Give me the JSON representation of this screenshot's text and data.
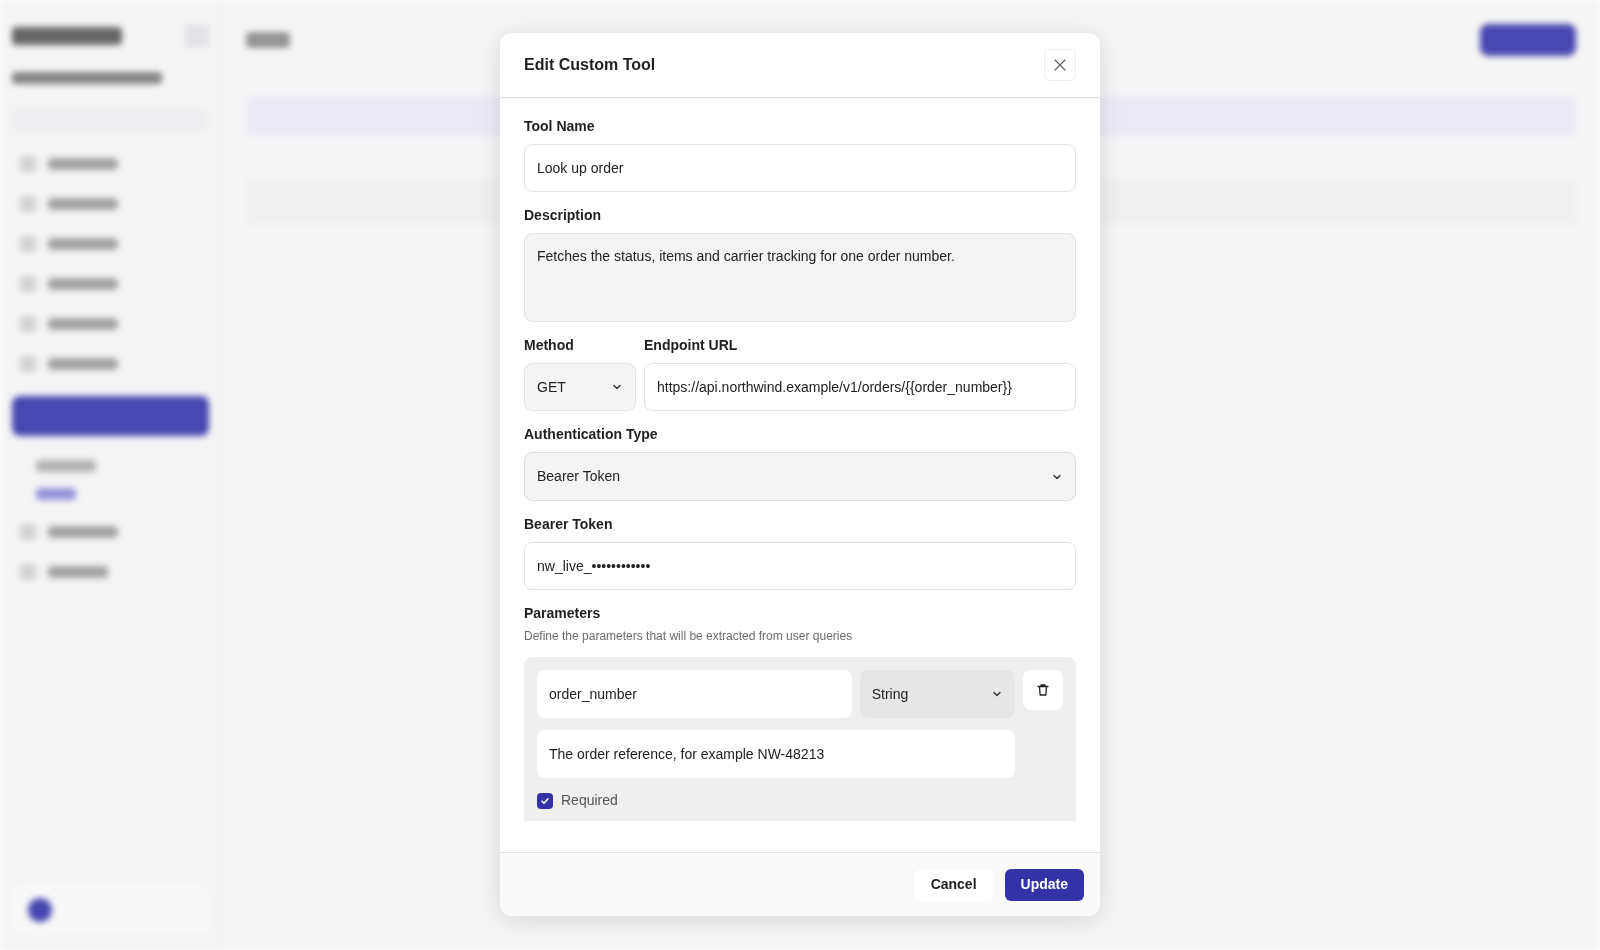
{
  "dialog": {
    "title": "Edit Custom Tool",
    "tool_name": {
      "label": "Tool Name",
      "value": "Look up order"
    },
    "description": {
      "label": "Description",
      "value": "Fetches the status, items and carrier tracking for one order number."
    },
    "method": {
      "label": "Method",
      "value": "GET"
    },
    "endpoint_url": {
      "label": "Endpoint URL",
      "value": "https://api.northwind.example/v1/orders/{{order_number}}"
    },
    "authentication_type": {
      "label": "Authentication Type",
      "value": "Bearer Token"
    },
    "bearer_token": {
      "label": "Bearer Token",
      "value": "nw_live_••••••••••••"
    },
    "parameters": {
      "title": "Parameters",
      "hint": "Define the parameters that will be extracted from user queries",
      "items": [
        {
          "name": "order_number",
          "type": "String",
          "description": "The order reference, for example NW-48213",
          "required_label": "Required",
          "required": true
        }
      ]
    },
    "buttons": [
      {
        "label": "Cancel",
        "kind": "secondary"
      },
      {
        "label": "Update",
        "kind": "primary"
      }
    ]
  }
}
